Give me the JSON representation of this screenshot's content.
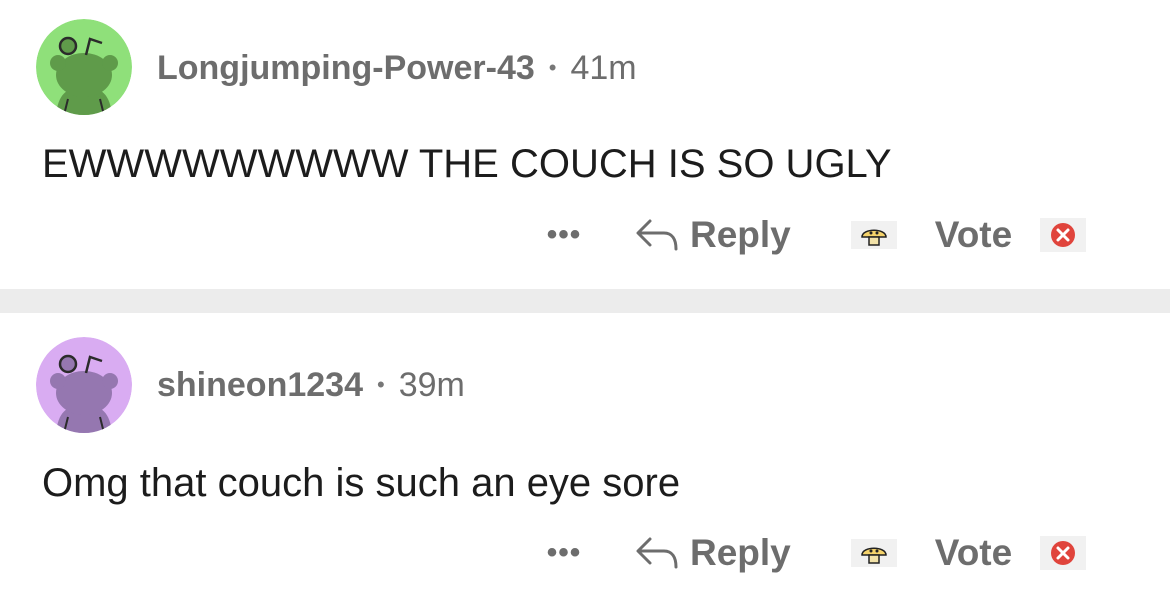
{
  "comments": [
    {
      "username": "Longjumping-Power-43",
      "separator": "•",
      "time": "41m",
      "text": "EWWWWWWWWW THE COUCH IS SO UGLY",
      "avatar_color": "#8fe07a",
      "avatar_figure_color": "#5f9b4a",
      "actions": {
        "more": "•••",
        "reply": "Reply",
        "vote": "Vote"
      }
    },
    {
      "username": "shineon1234",
      "separator": "•",
      "time": "39m",
      "text": "Omg that couch is such an eye sore",
      "avatar_color": "#d9acf2",
      "avatar_figure_color": "#9577b0",
      "actions": {
        "more": "•••",
        "reply": "Reply",
        "vote": "Vote"
      }
    }
  ],
  "icons": {
    "avatar": "reddit-snoo-avatar-icon",
    "reply": "reply-arrow-icon",
    "upvote": "upvote-mushroom-icon",
    "downvote": "downvote-red-x-icon"
  }
}
